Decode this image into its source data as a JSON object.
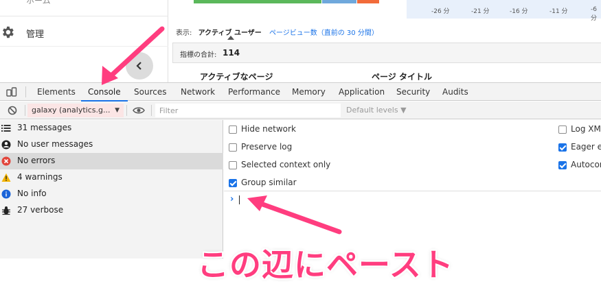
{
  "page": {
    "nav": {
      "admin_label": "管理",
      "cut_label": "ホーム"
    },
    "timeline_ticks": [
      "-26 分",
      "-21 分",
      "-16 分",
      "-11 分",
      "-6 分"
    ],
    "view": {
      "label": "表示:",
      "active": "アクティブ ユーザー",
      "link": "ページビュー数（直前の 30 分間）"
    },
    "metric": {
      "label": "指標の合計:",
      "value": "114"
    },
    "columns": [
      "アクティブなページ",
      "ページ タイトル"
    ],
    "colors": {
      "green": "#5bb85b",
      "blue": "#6fa8dc",
      "orange": "#f26b3a"
    }
  },
  "devtools": {
    "tabs": [
      "Elements",
      "Console",
      "Sources",
      "Network",
      "Performance",
      "Memory",
      "Application",
      "Security",
      "Audits"
    ],
    "active_tab": "Console",
    "toolbar": {
      "context": "galaxy (analytics.g...",
      "filter_placeholder": "Filter",
      "levels": "Default levels ▼"
    },
    "sidebar": [
      {
        "icon": "list-icon",
        "label": "31 messages"
      },
      {
        "icon": "user-icon",
        "label": "No user messages"
      },
      {
        "icon": "error-icon",
        "label": "No errors"
      },
      {
        "icon": "warning-icon",
        "label": "4 warnings"
      },
      {
        "icon": "info-icon",
        "label": "No info"
      },
      {
        "icon": "bug-icon",
        "label": "27 verbose"
      }
    ],
    "settings_left": [
      {
        "label": "Hide network",
        "checked": false
      },
      {
        "label": "Preserve log",
        "checked": false
      },
      {
        "label": "Selected context only",
        "checked": false
      },
      {
        "label": "Group similar",
        "checked": true
      }
    ],
    "settings_right": [
      {
        "label": "Log XML",
        "checked": false
      },
      {
        "label": "Eager ev",
        "checked": true
      },
      {
        "label": "Autocom",
        "checked": true
      }
    ],
    "prompt_symbol": "›",
    "accent": "#1a73e8"
  },
  "annotation": {
    "caption": "この辺にペースト",
    "color": "#ff3d7f"
  }
}
